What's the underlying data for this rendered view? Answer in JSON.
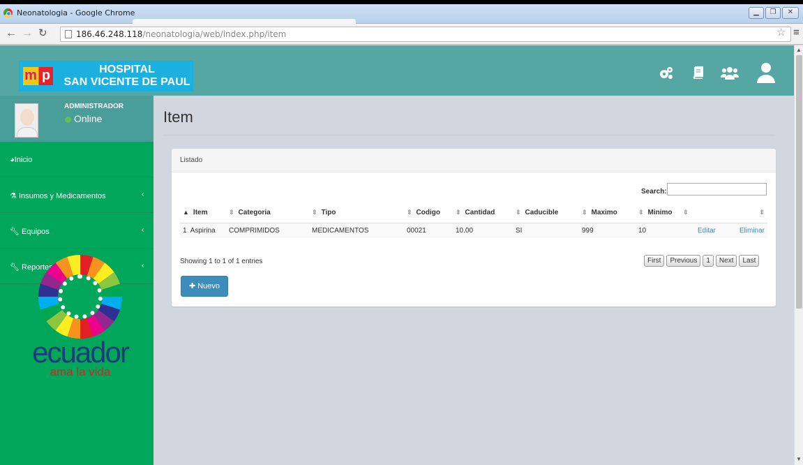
{
  "browser": {
    "window_title": "Neonatologia - Google Chrome",
    "url_host": "186.46.248.118",
    "url_path": "/neonatologia/web/index.php/item"
  },
  "header": {
    "logo_line1": "HOSPITAL",
    "logo_line2": "SAN VICENTE DE PAUL",
    "logo_m": "m",
    "logo_p": "p"
  },
  "sidebar": {
    "user_name": "ADMINISTRADOR",
    "user_status": "Online",
    "items": [
      {
        "label": "Inicio"
      },
      {
        "label": "Insumos y Medicamentos"
      },
      {
        "label": "Equipos"
      },
      {
        "label": "Reportes"
      }
    ],
    "brand_word": "ecuador",
    "brand_tagline": "ama la vida"
  },
  "main": {
    "page_title": "Item",
    "box_title": "Listado",
    "search_label": "Search:",
    "search_value": "",
    "columns": [
      "Item",
      "Categoria",
      "Tipo",
      "Codigo",
      "Cantidad",
      "Caducible",
      "Maximo",
      "Minimo",
      "",
      ""
    ],
    "rows": [
      {
        "num": "1",
        "item": "Aspirina",
        "categoria": "COMPRIMIDOS",
        "tipo": "MEDICAMENTOS",
        "codigo": "00021",
        "cantidad": "10.00",
        "caducible": "SI",
        "maximo": "999",
        "minimo": "10",
        "edit": "Editar",
        "delete": "Eliminar"
      }
    ],
    "info": "Showing 1 to 1 of 1 entries",
    "pager": {
      "first": "First",
      "previous": "Previous",
      "page": "1",
      "next": "Next",
      "last": "Last"
    },
    "new_button": "Nuevo"
  },
  "colors": {
    "header": "#56a6a3",
    "sidebar": "#00a65a",
    "accent": "#3c8dbc",
    "content_bg": "#d2d6de"
  }
}
